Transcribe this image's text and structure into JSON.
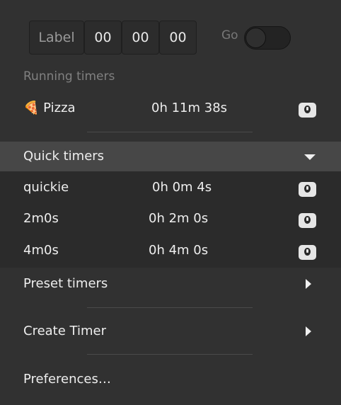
{
  "new_timer": {
    "label": "Label",
    "hours": "00",
    "minutes": "00",
    "seconds": "00",
    "go_label": "Go"
  },
  "running": {
    "section_label": "Running timers",
    "items": [
      {
        "emoji": "🍕",
        "name": "Pizza",
        "time": "0h 11m 38s"
      }
    ]
  },
  "quick": {
    "title": "Quick timers",
    "items": [
      {
        "name": "quickie",
        "time": "0h 0m 4s"
      },
      {
        "name": "2m0s",
        "time": "0h 2m 0s"
      },
      {
        "name": "4m0s",
        "time": "0h 4m 0s"
      }
    ]
  },
  "menu": {
    "preset": "Preset timers",
    "create": "Create Timer",
    "preferences": "Preferences…"
  },
  "icons": {
    "stop": "stopwatch-icon",
    "expand": "triangle-down-icon",
    "submenu": "triangle-right-icon"
  }
}
